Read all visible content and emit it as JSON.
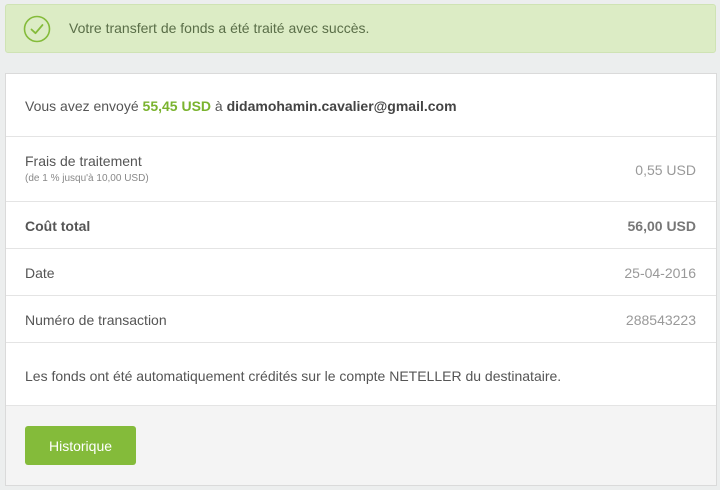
{
  "alert": {
    "message": "Votre transfert de fonds a été traité avec succès.",
    "icon": "check-circle-icon"
  },
  "summary": {
    "prefix": "Vous avez envoyé ",
    "amount": "55,45 USD",
    "middle": " à ",
    "recipient": "didamohamin.cavalier@gmail.com"
  },
  "fee": {
    "label": "Frais de traitement",
    "note": "(de 1 % jusqu'à 10,00 USD)",
    "value": "0,55 USD"
  },
  "total": {
    "label": "Coût total",
    "value": "56,00 USD"
  },
  "date": {
    "label": "Date",
    "value": "25-04-2016"
  },
  "transaction": {
    "label": "Numéro de transaction",
    "value": "288543223"
  },
  "note": "Les fonds ont été automatiquement crédités sur le compte NETELLER du destinataire.",
  "footer": {
    "history_button": "Historique"
  },
  "colors": {
    "accent": "#84bb3a",
    "success_bg": "#dcecc5"
  }
}
